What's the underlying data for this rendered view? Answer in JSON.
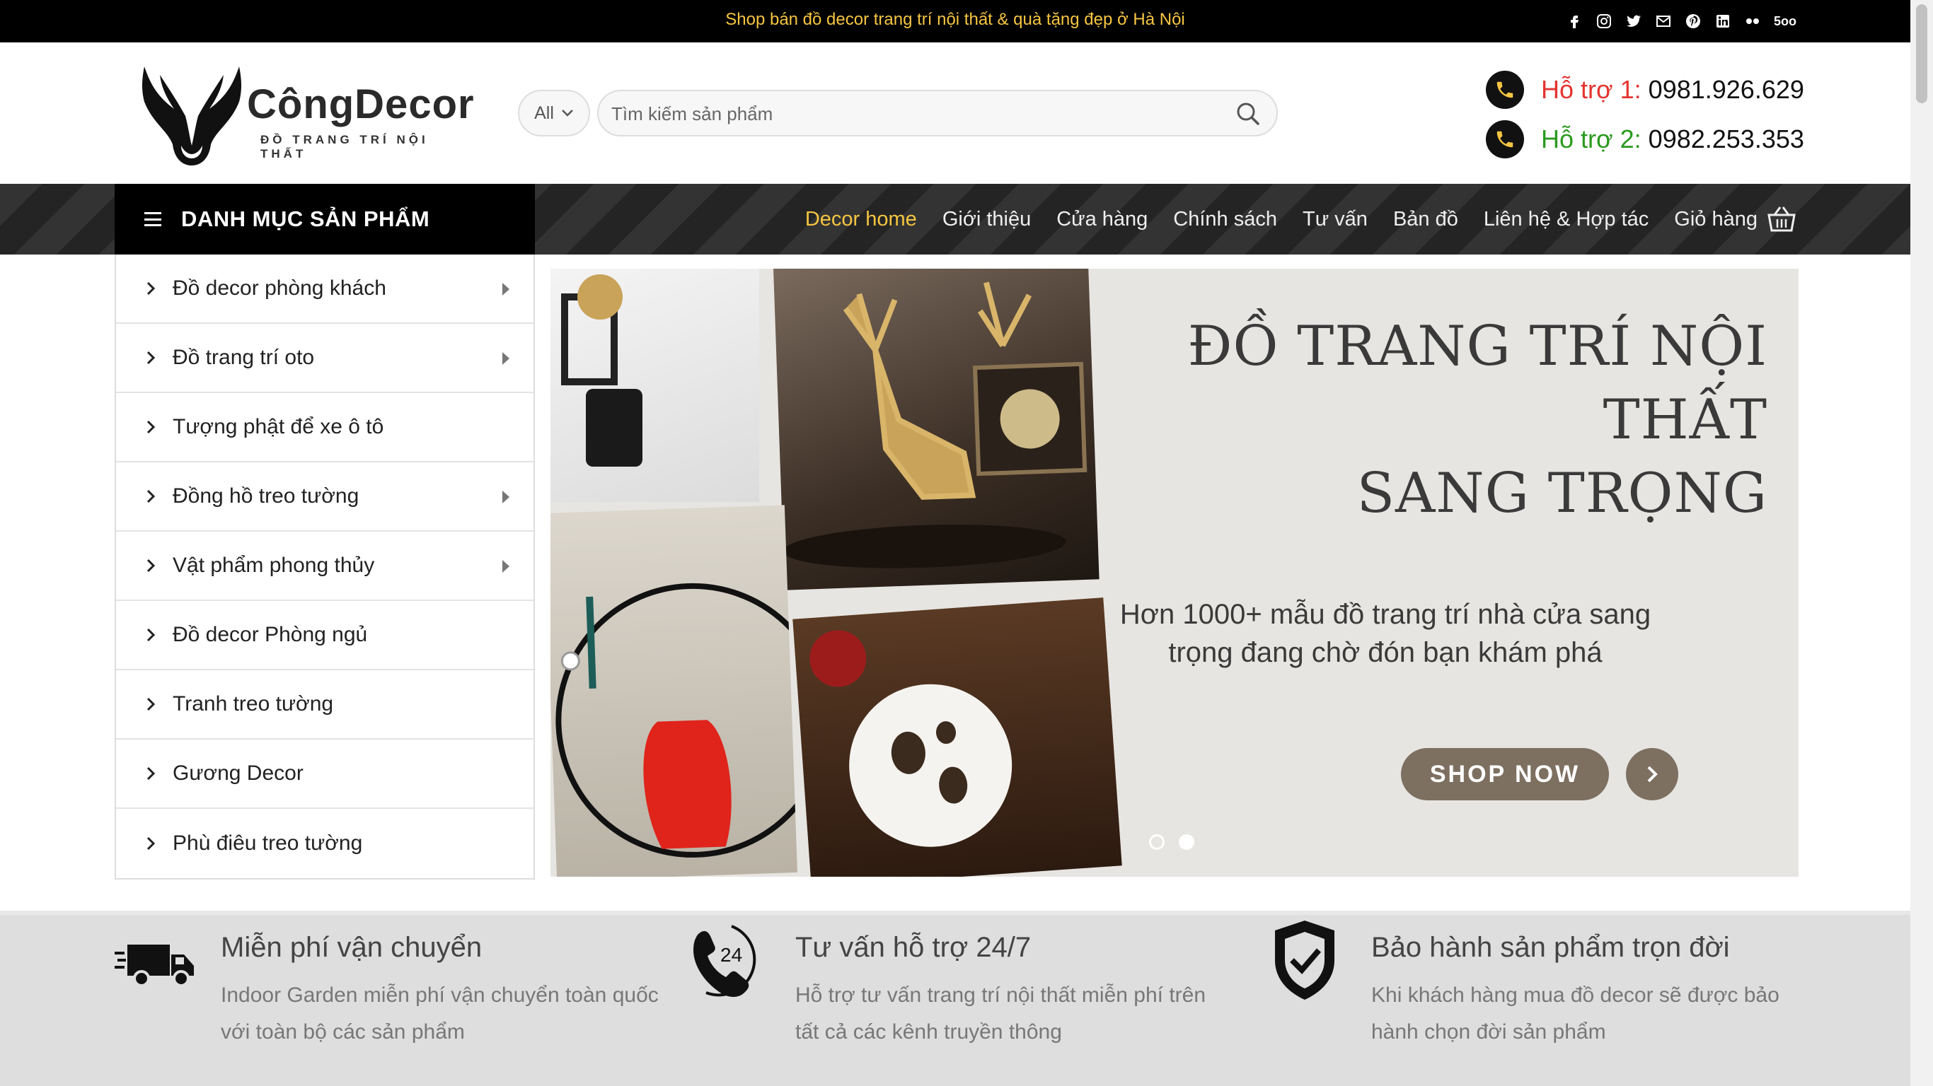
{
  "topbar": {
    "promo": "Shop bán đồ decor trang trí nội thất & quà tặng đẹp ở Hà Nội",
    "socials": [
      "facebook-icon",
      "instagram-icon",
      "twitter-icon",
      "email-icon",
      "pinterest-icon",
      "linkedin-icon",
      "flickr-icon",
      "500px-icon"
    ],
    "socials_500": "5oo"
  },
  "logo": {
    "brand": "CôngDecor",
    "tagline": "ĐỒ TRANG TRÍ NỘI THẤT"
  },
  "search": {
    "category": "All",
    "placeholder": "Tìm kiếm sản phẩm"
  },
  "hotlines": [
    {
      "label": "Hỗ trợ 1:",
      "number": "0981.926.629"
    },
    {
      "label": "Hỗ trợ 2:",
      "number": "0982.253.353"
    }
  ],
  "category_button": "DANH MỤC SẢN PHẨM",
  "nav": {
    "items": [
      "Decor home",
      "Giới thiệu",
      "Cửa hàng",
      "Chính sách",
      "Tư vấn",
      "Bản đồ",
      "Liên hệ & Hợp tác"
    ],
    "cart": "Giỏ hàng",
    "active": "Decor home"
  },
  "sidemenu": [
    {
      "label": "Đồ decor phòng khách",
      "has_sub": true
    },
    {
      "label": "Đồ trang trí oto",
      "has_sub": true
    },
    {
      "label": "Tượng phật để xe ô tô",
      "has_sub": false
    },
    {
      "label": "Đồng hồ treo tường",
      "has_sub": true
    },
    {
      "label": "Vật phẩm phong thủy",
      "has_sub": true
    },
    {
      "label": "Đồ decor Phòng ngủ",
      "has_sub": false
    },
    {
      "label": "Tranh treo tường",
      "has_sub": false
    },
    {
      "label": "Gương Decor",
      "has_sub": false
    },
    {
      "label": "Phù điêu treo tường",
      "has_sub": false
    }
  ],
  "banner": {
    "headline_1": "ĐỒ TRANG TRÍ NỘI THẤT",
    "headline_2": "SANG TRỌNG",
    "sub_1": "Hơn 1000+ mẫu đồ trang trí nhà cửa sang",
    "sub_2": "trọng đang chờ đón bạn khám phá",
    "cta": "SHOP NOW",
    "slide_count": 2,
    "active_slide": 2
  },
  "features": [
    {
      "icon": "truck-icon",
      "title": "Miễn phí vận chuyển",
      "desc": "Indoor Garden miễn phí vận chuyển toàn quốc với toàn bộ các sản phẩm"
    },
    {
      "icon": "phone-24-icon",
      "title": "Tư vấn hỗ trợ 24/7",
      "desc": "Hỗ trợ tư vấn trang trí nội thất miễn phí trên tất cả các kênh truyền thông"
    },
    {
      "icon": "shield-check-icon",
      "title": "Bảo hành sản phẩm trọn đời",
      "desc": "Khi khách hàng mua đồ decor sẽ được bảo hành chọn đời sản phẩm"
    }
  ],
  "colors": {
    "accent_gold": "#f5c542",
    "red": "#e3342f",
    "green": "#2a9a1e",
    "cta_brown": "#7d7061"
  }
}
